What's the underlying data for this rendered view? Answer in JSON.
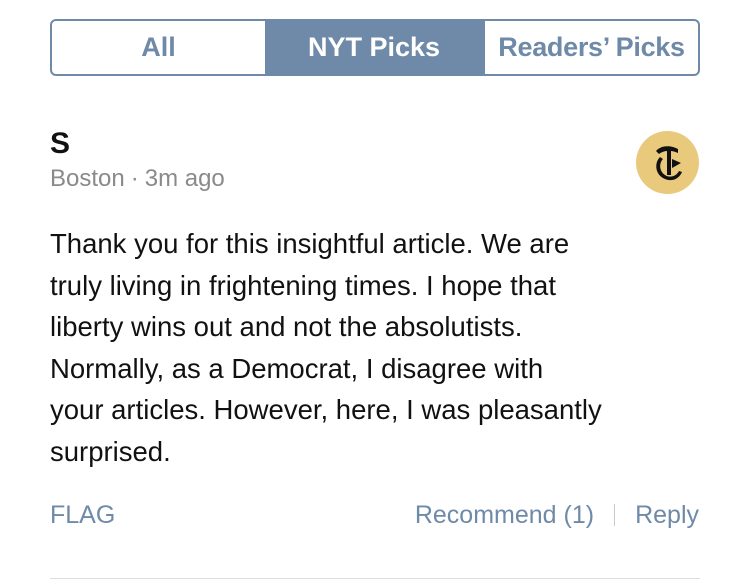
{
  "tabs": [
    {
      "label": "All",
      "selected": false
    },
    {
      "label": "NYT Picks",
      "selected": true
    },
    {
      "label": "Readers’ Picks",
      "selected": false
    }
  ],
  "comment": {
    "author": "S",
    "location": "Boston",
    "separator": "·",
    "time": "3m ago",
    "badge_icon": "nyt-logo-icon",
    "body_lines": [
      "Thank you for this insightful article. We are",
      "truly living in frightening times. I hope that",
      "liberty wins out and not the absolutists.",
      "Normally, as a Democrat, I disagree with",
      "your articles. However, here, I was pleasantly",
      "surprised."
    ]
  },
  "actions": {
    "flag": "FLAG",
    "recommend": "Recommend (1)",
    "reply": "Reply"
  },
  "colors": {
    "accent": "#6e8aa8",
    "badge_bg": "#e9c97c",
    "meta_text": "#8a8a8a",
    "body_text": "#111111"
  }
}
